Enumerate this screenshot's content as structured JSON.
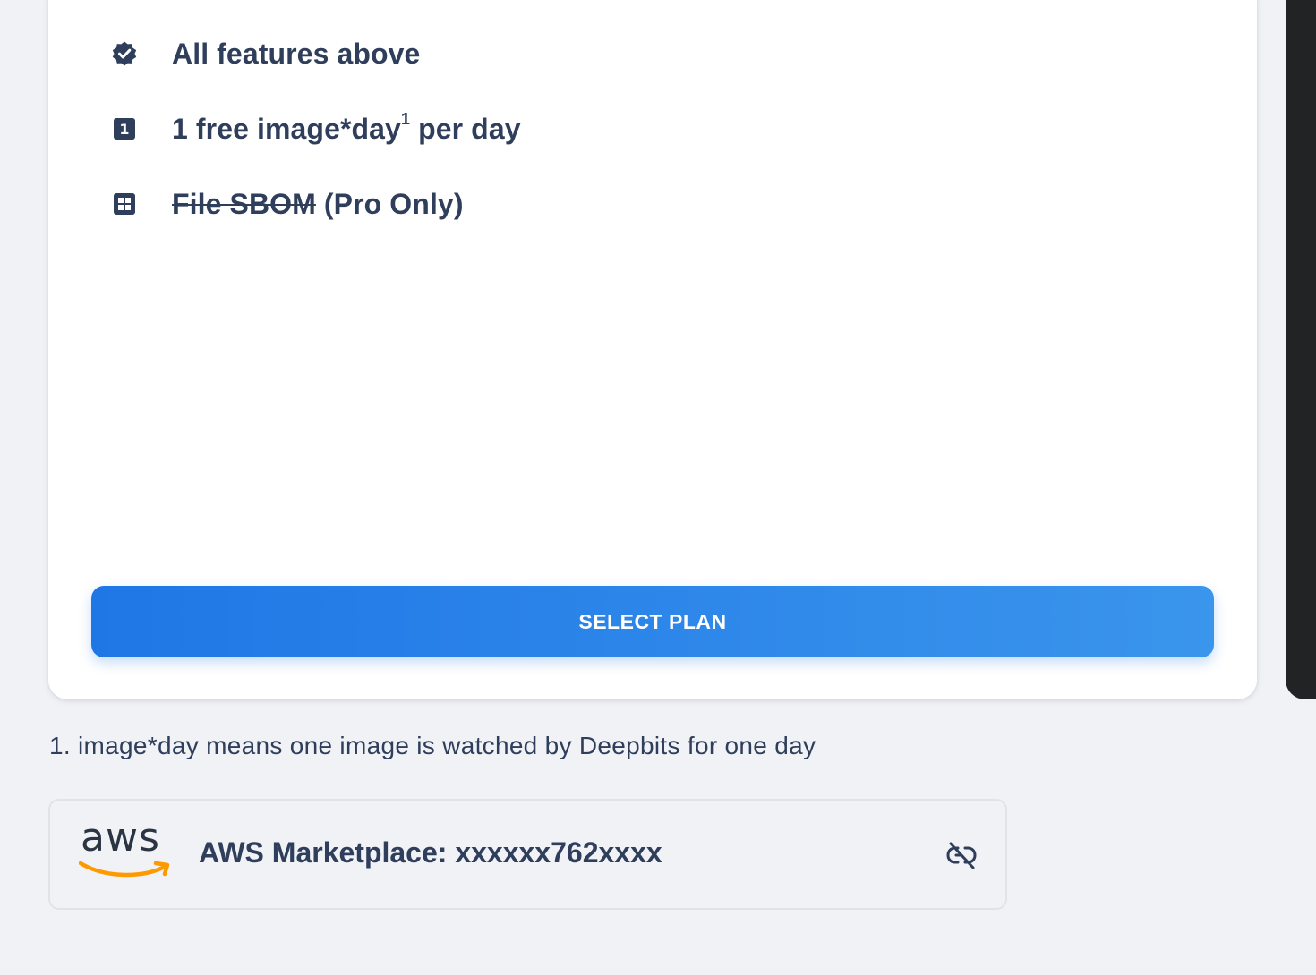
{
  "plan_card": {
    "features": [
      {
        "icon": "verified-badge-icon",
        "text": "All features above"
      },
      {
        "icon": "number-one-box-icon",
        "text_main": "1 free image*day",
        "sup": "1",
        "text_tail": " per day"
      },
      {
        "icon": "grid-box-icon",
        "text_strike": "File SBOM",
        "text_tail": " (Pro Only)"
      }
    ],
    "select_button": "SELECT PLAN",
    "accent_color": "#1f77e6"
  },
  "footnote": "1. image*day means one image is watched by Deepbits for one day",
  "aws_marketplace": {
    "logo_text": "aws",
    "label": "AWS Marketplace: xxxxxx762xxxx",
    "unlink_icon": "unlink-icon",
    "logo_accent_color": "#ff9900"
  },
  "number_icon_glyph": "1"
}
